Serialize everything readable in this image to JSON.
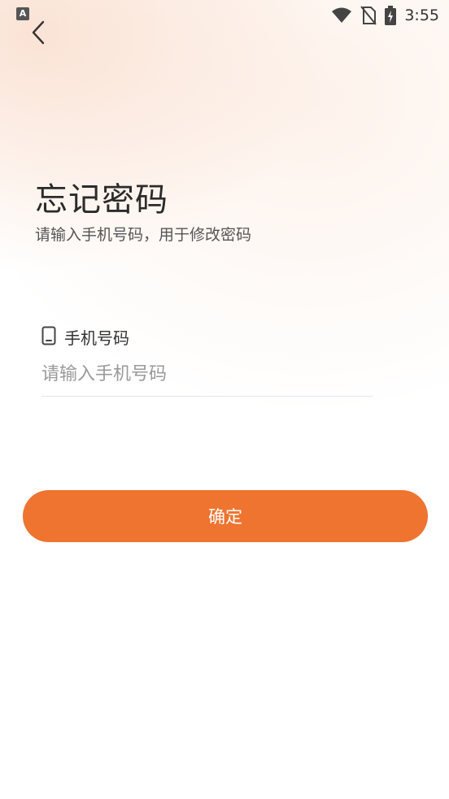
{
  "status_bar": {
    "app_icon_letter": "A",
    "time": "3:55",
    "icons": [
      "wifi-icon",
      "no-sim-icon",
      "battery-charging-icon"
    ]
  },
  "nav": {
    "back_icon": "chevron-left-icon"
  },
  "header": {
    "title": "忘记密码",
    "subtitle": "请输入手机号码，用于修改密码"
  },
  "form": {
    "phone": {
      "icon": "phone-icon",
      "label": "手机号码",
      "value": "",
      "placeholder": "请输入手机号码"
    }
  },
  "actions": {
    "confirm_label": "确定"
  },
  "colors": {
    "accent": "#ee7430",
    "title_text": "#2b2b2b",
    "placeholder_text": "#9a9a9a"
  }
}
